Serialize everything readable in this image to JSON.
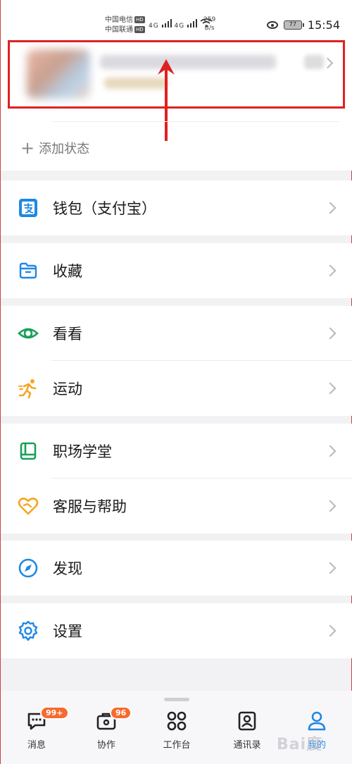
{
  "status_bar": {
    "carrier_1": "中国电信",
    "carrier_2": "中国联通",
    "hd_label": "HD",
    "network_label": "4G",
    "net_speed_value": "259",
    "net_speed_unit": "B/s",
    "battery": "77",
    "time": "15:54"
  },
  "profile": {
    "add_status": "添加状态"
  },
  "menu": {
    "wallet": "钱包（支付宝）",
    "favorites": "收藏",
    "watch": "看看",
    "sports": "运动",
    "career": "职场学堂",
    "support": "客服与帮助",
    "discover": "发现",
    "settings": "设置"
  },
  "tabs": [
    {
      "label": "消息",
      "badge": "99+"
    },
    {
      "label": "协作",
      "badge": "96"
    },
    {
      "label": "工作台"
    },
    {
      "label": "通讯录"
    },
    {
      "label": "我的"
    }
  ],
  "watermark": "Bai度",
  "colors": {
    "accent_blue": "#1e88e5",
    "badge_orange": "#f56a2e",
    "highlight_red": "#e02020",
    "watch_green": "#18a058",
    "sports_orange": "#f5a623"
  }
}
